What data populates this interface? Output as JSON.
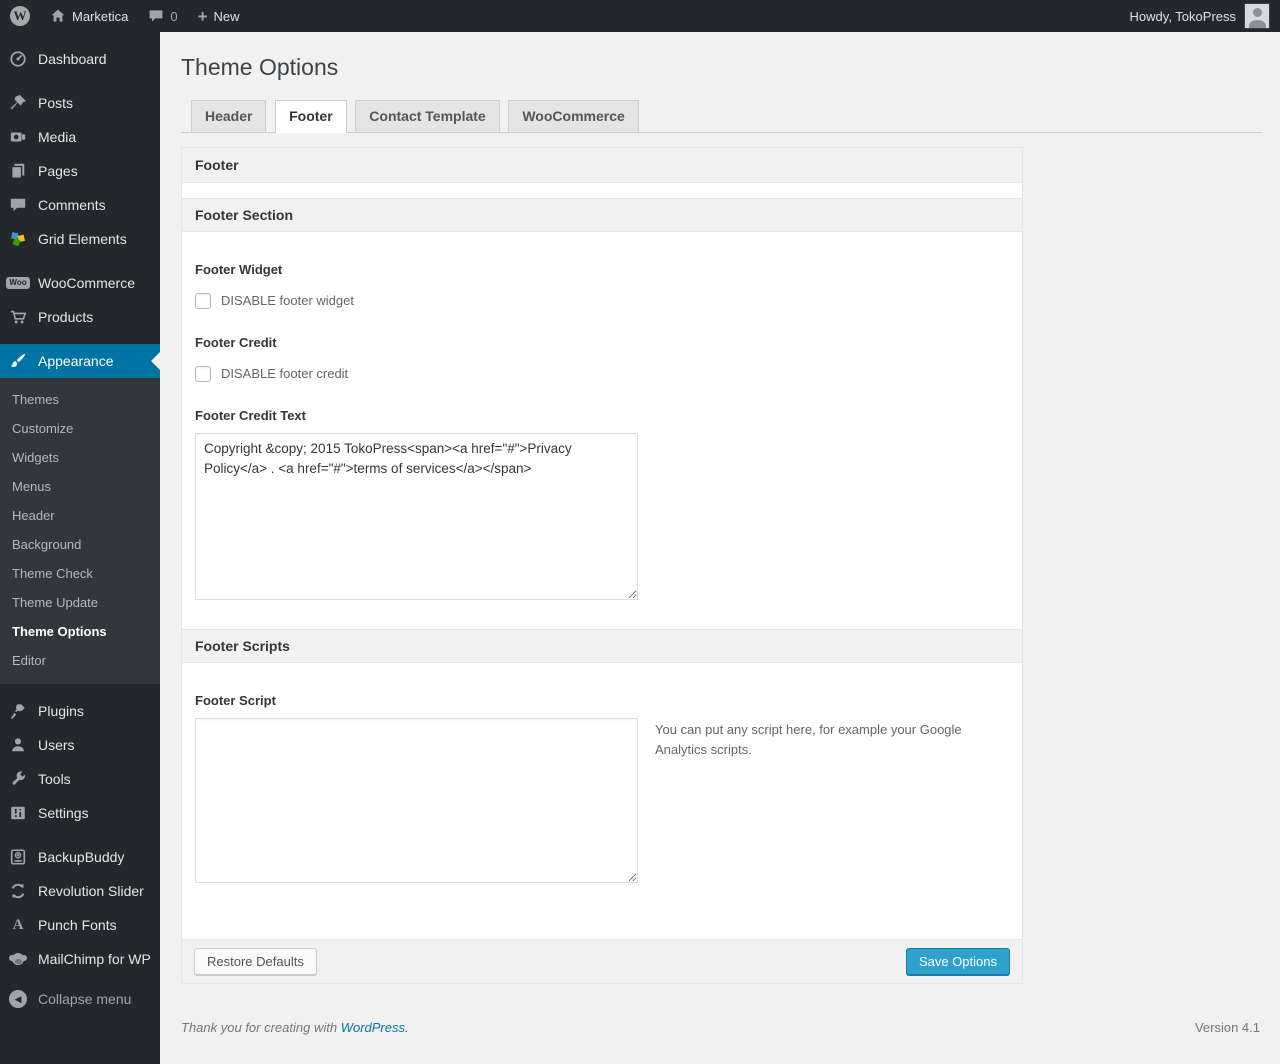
{
  "colors": {
    "accent": "#0074a2",
    "primary_button": "#2ea2cc",
    "admin_bar_bg": "#23282d",
    "page_bg": "#f1f1f1"
  },
  "admin_bar": {
    "site_name": "Marketica",
    "comments_count": "0",
    "new_label": "New",
    "howdy": "Howdy, TokoPress"
  },
  "icon_glyphs": {
    "wp": "W",
    "woo": "Woo",
    "punch_fonts": "A",
    "plus": "+",
    "collapse": "◀"
  },
  "sidebar": {
    "items": [
      {
        "label": "Dashboard",
        "icon": "dashboard-icon"
      },
      {
        "label": "Posts",
        "icon": "pushpin-icon"
      },
      {
        "label": "Media",
        "icon": "camera-icon"
      },
      {
        "label": "Pages",
        "icon": "pages-icon"
      },
      {
        "label": "Comments",
        "icon": "comment-icon"
      },
      {
        "label": "Grid Elements",
        "icon": "grid-elements-icon"
      },
      {
        "label": "WooCommerce",
        "icon": "woo-badge-icon"
      },
      {
        "label": "Products",
        "icon": "cart-icon"
      },
      {
        "label": "Appearance",
        "icon": "brush-icon",
        "active": true
      },
      {
        "label": "Plugins",
        "icon": "plug-icon"
      },
      {
        "label": "Users",
        "icon": "user-icon"
      },
      {
        "label": "Tools",
        "icon": "wrench-icon"
      },
      {
        "label": "Settings",
        "icon": "sliders-icon"
      },
      {
        "label": "BackupBuddy",
        "icon": "backup-drive-icon"
      },
      {
        "label": "Revolution Slider",
        "icon": "refresh-icon"
      },
      {
        "label": "Punch Fonts",
        "icon": "letter-a-icon"
      },
      {
        "label": "MailChimp for WP",
        "icon": "monkey-icon"
      },
      {
        "label": "Collapse menu",
        "icon": "collapse-arrow-icon"
      }
    ],
    "appearance_submenu": [
      "Themes",
      "Customize",
      "Widgets",
      "Menus",
      "Header",
      "Background",
      "Theme Check",
      "Theme Update",
      "Theme Options",
      "Editor"
    ],
    "current_submenu": "Theme Options"
  },
  "main": {
    "title": "Theme Options",
    "tabs": [
      {
        "label": "Header",
        "active": false
      },
      {
        "label": "Footer",
        "active": true
      },
      {
        "label": "Contact Template",
        "active": false
      },
      {
        "label": "WooCommerce",
        "active": false
      }
    ],
    "panel_title": "Footer",
    "sections": [
      {
        "title": "Footer Section"
      },
      {
        "title": "Footer Scripts"
      }
    ],
    "fields": {
      "footer_widget": {
        "label": "Footer Widget",
        "checkbox_label": "DISABLE footer widget",
        "checked": false
      },
      "footer_credit": {
        "label": "Footer Credit",
        "checkbox_label": "DISABLE footer credit",
        "checked": false
      },
      "footer_credit_text": {
        "label": "Footer Credit Text",
        "value": "Copyright &copy; 2015 TokoPress<span><a href=\"#\">Privacy Policy</a> . <a href=\"#\">terms of services</a></span>"
      },
      "footer_script": {
        "label": "Footer Script",
        "value": "",
        "help": "You can put any script here, for example your Google Analytics scripts."
      }
    },
    "actions": {
      "restore": "Restore Defaults",
      "save": "Save Options"
    }
  },
  "page_footer": {
    "thanks_text": "Thank you for creating with ",
    "wordpress_link": "WordPress.",
    "version": "Version 4.1"
  }
}
